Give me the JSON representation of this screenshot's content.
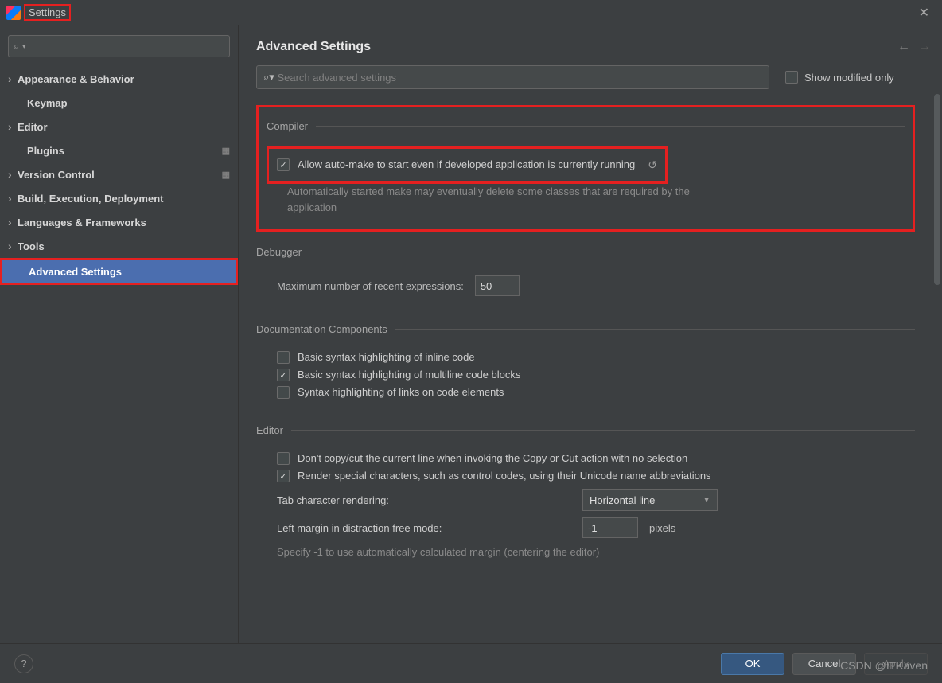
{
  "window": {
    "title": "Settings"
  },
  "sidebar": {
    "items": [
      {
        "label": "Appearance & Behavior",
        "expandable": true,
        "bold": true
      },
      {
        "label": "Keymap",
        "expandable": false,
        "bold": true
      },
      {
        "label": "Editor",
        "expandable": true,
        "bold": true
      },
      {
        "label": "Plugins",
        "expandable": false,
        "bold": true,
        "gear": true
      },
      {
        "label": "Version Control",
        "expandable": true,
        "bold": true,
        "gear": true
      },
      {
        "label": "Build, Execution, Deployment",
        "expandable": true,
        "bold": true
      },
      {
        "label": "Languages & Frameworks",
        "expandable": true,
        "bold": true
      },
      {
        "label": "Tools",
        "expandable": true,
        "bold": true
      },
      {
        "label": "Advanced Settings",
        "expandable": false,
        "bold": true,
        "selected": true
      }
    ]
  },
  "content": {
    "title": "Advanced Settings",
    "search_placeholder": "Search advanced settings",
    "show_modified_label": "Show modified only",
    "show_modified_checked": false
  },
  "compiler": {
    "title": "Compiler",
    "allow_auto_make": {
      "label": "Allow auto-make to start even if developed application is currently running",
      "checked": true,
      "help": "Automatically started make may eventually delete some classes that are required by the application"
    }
  },
  "debugger": {
    "title": "Debugger",
    "max_expr_label": "Maximum number of recent expressions:",
    "max_expr_value": "50"
  },
  "doc_components": {
    "title": "Documentation Components",
    "opts": [
      {
        "label": "Basic syntax highlighting of inline code",
        "checked": false
      },
      {
        "label": "Basic syntax highlighting of multiline code blocks",
        "checked": true
      },
      {
        "label": "Syntax highlighting of links on code elements",
        "checked": false
      }
    ]
  },
  "editor": {
    "title": "Editor",
    "opts": [
      {
        "label": "Don't copy/cut the current line when invoking the Copy or Cut action with no selection",
        "checked": false
      },
      {
        "label": "Render special characters, such as control codes, using their Unicode name abbreviations",
        "checked": true
      }
    ],
    "tab_render_label": "Tab character rendering:",
    "tab_render_value": "Horizontal line",
    "left_margin_label": "Left margin in distraction free mode:",
    "left_margin_value": "-1",
    "left_margin_unit": "pixels",
    "left_margin_help": "Specify -1 to use automatically calculated margin (centering the editor)"
  },
  "footer": {
    "ok": "OK",
    "cancel": "Cancel",
    "apply": "Apply"
  },
  "watermark": "CSDN @ITKaven"
}
